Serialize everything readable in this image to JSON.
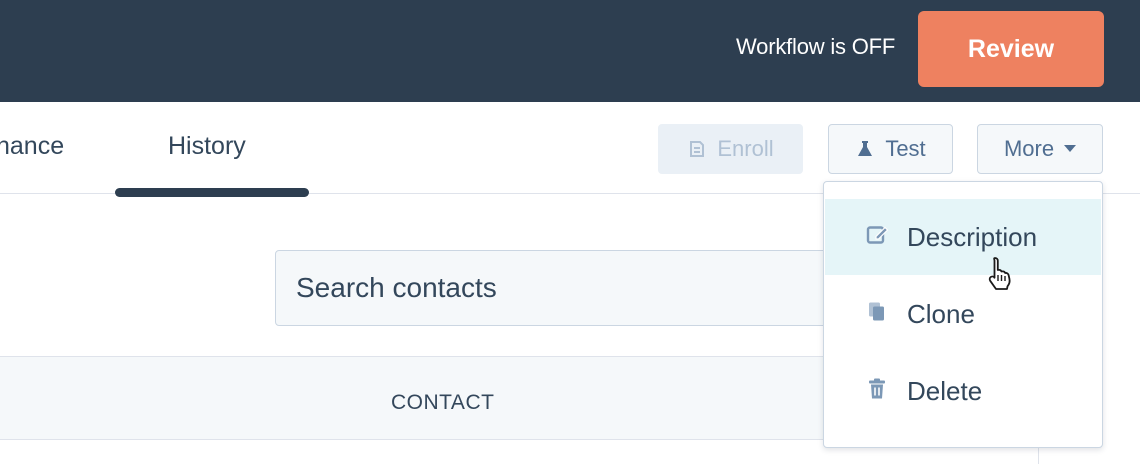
{
  "header": {
    "workflow_status": "Workflow is OFF",
    "review_label": "Review"
  },
  "tabs": {
    "performance_label": "nance",
    "history_label": "History",
    "active": "History"
  },
  "toolbar": {
    "enroll_label": "Enroll",
    "test_label": "Test",
    "more_label": "More"
  },
  "search": {
    "placeholder": "Search contacts",
    "value": ""
  },
  "table": {
    "columns": [
      "CONTACT"
    ]
  },
  "more_menu": {
    "items": [
      {
        "label": "Description",
        "icon": "edit-icon",
        "highlighted": true
      },
      {
        "label": "Clone",
        "icon": "copy-icon"
      },
      {
        "label": "Delete",
        "icon": "trash-icon"
      }
    ]
  },
  "colors": {
    "topbar": "#2d3e50",
    "accent": "#ee8160",
    "menu_highlight": "#e5f5f8"
  }
}
